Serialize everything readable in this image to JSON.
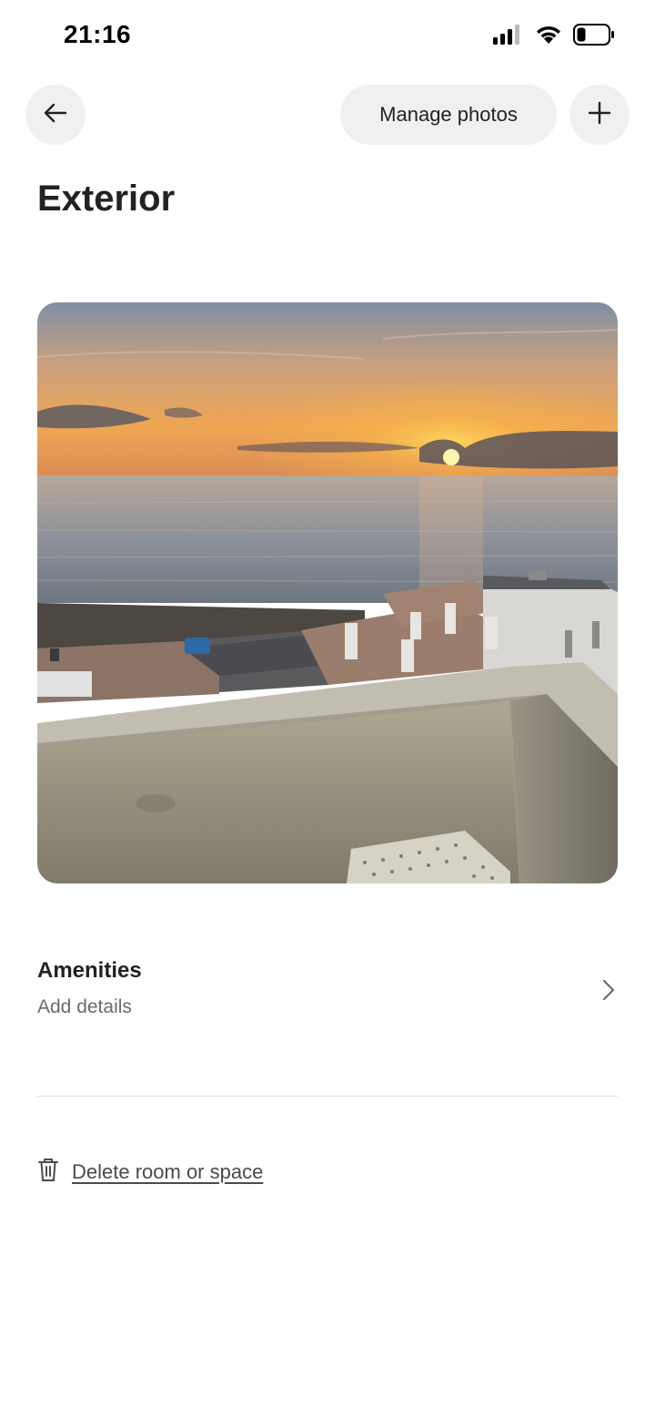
{
  "status_bar": {
    "time": "21:16",
    "icons": [
      "cellular-signal-icon",
      "wifi-icon",
      "battery-icon"
    ]
  },
  "header": {
    "back_icon": "arrow-left-icon",
    "manage_label": "Manage photos",
    "add_icon": "plus-icon"
  },
  "page": {
    "title": "Exterior"
  },
  "photo": {
    "icon": "photo-sunset-balcony"
  },
  "amenities": {
    "title": "Amenities",
    "subtitle": "Add details",
    "icon": "chevron-right-icon"
  },
  "delete": {
    "label": "Delete room or space",
    "icon": "trash-icon"
  },
  "colors": {
    "background": "#ffffff",
    "button_bg": "#f0f0f0",
    "text_primary": "#222222",
    "text_secondary": "#6a6a6a",
    "divider": "#dddddd"
  }
}
